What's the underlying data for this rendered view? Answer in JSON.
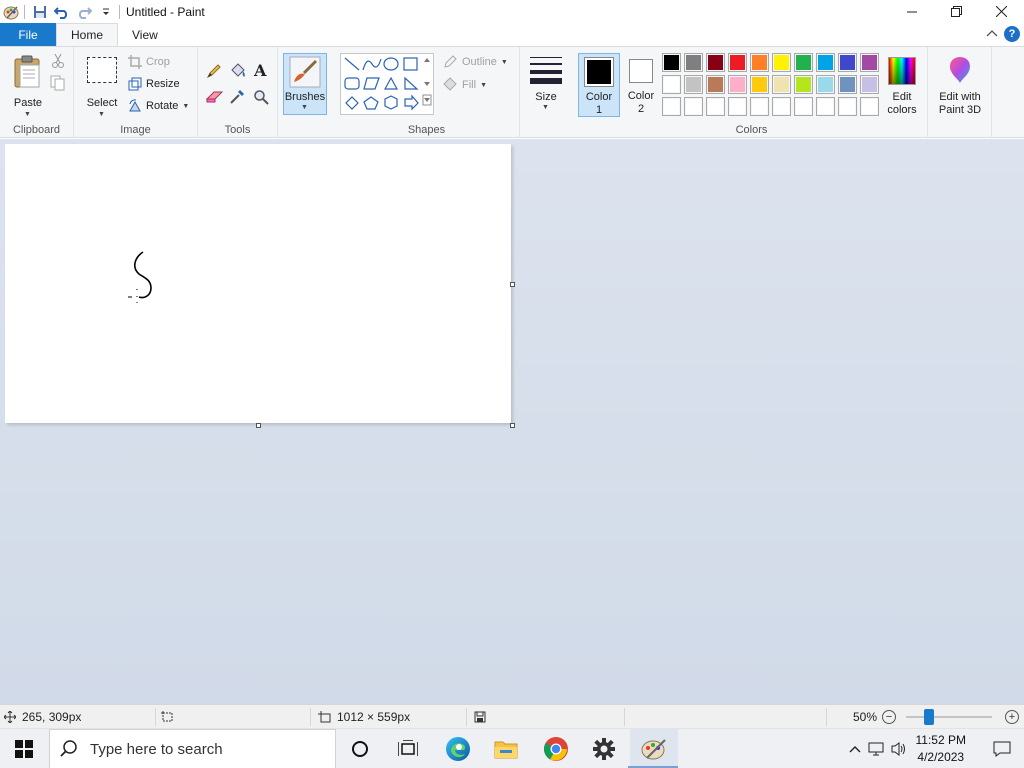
{
  "titlebar": {
    "title": "Untitled - Paint",
    "minimize": "minimize",
    "maximize": "maximize",
    "close": "close"
  },
  "tabs": {
    "file": "File",
    "home": "Home",
    "view": "View"
  },
  "ribbon": {
    "clipboard": {
      "label": "Clipboard",
      "paste": "Paste"
    },
    "image": {
      "label": "Image",
      "select": "Select",
      "crop": "Crop",
      "resize": "Resize",
      "rotate": "Rotate"
    },
    "tools": {
      "label": "Tools"
    },
    "brushes": {
      "label": "Brushes"
    },
    "shapes": {
      "label": "Shapes",
      "outline": "Outline",
      "fill": "Fill"
    },
    "size": {
      "label": "Size"
    },
    "color1": {
      "label": "Color",
      "num": "1"
    },
    "color2": {
      "label": "Color",
      "num": "2"
    },
    "colors": {
      "label": "Colors"
    },
    "edit_colors": {
      "line1": "Edit",
      "line2": "colors"
    },
    "paint3d": {
      "line1": "Edit with",
      "line2": "Paint 3D"
    }
  },
  "palette": {
    "row1": [
      "#000000",
      "#7f7f7f",
      "#880015",
      "#ed1c24",
      "#ff7f27",
      "#fff200",
      "#22b14c",
      "#00a2e8",
      "#3f48cc",
      "#a349a4"
    ],
    "row2": [
      "#ffffff",
      "#c3c3c3",
      "#b97a57",
      "#ffaec9",
      "#ffc90e",
      "#efe4b0",
      "#b5e61d",
      "#99d9ea",
      "#7092be",
      "#c8bfe7"
    ],
    "row3": [
      "#ffffff",
      "#ffffff",
      "#ffffff",
      "#ffffff",
      "#ffffff",
      "#ffffff",
      "#ffffff",
      "#ffffff",
      "#ffffff",
      "#ffffff"
    ],
    "color1": "#000000",
    "color2": "#ffffff"
  },
  "status": {
    "cursor_pos": "265, 309px",
    "image_size": "1012 × 559px",
    "zoom": "50%"
  },
  "taskbar": {
    "search_placeholder": "Type here to search",
    "time": "11:52 PM",
    "date": "4/2/2023"
  }
}
